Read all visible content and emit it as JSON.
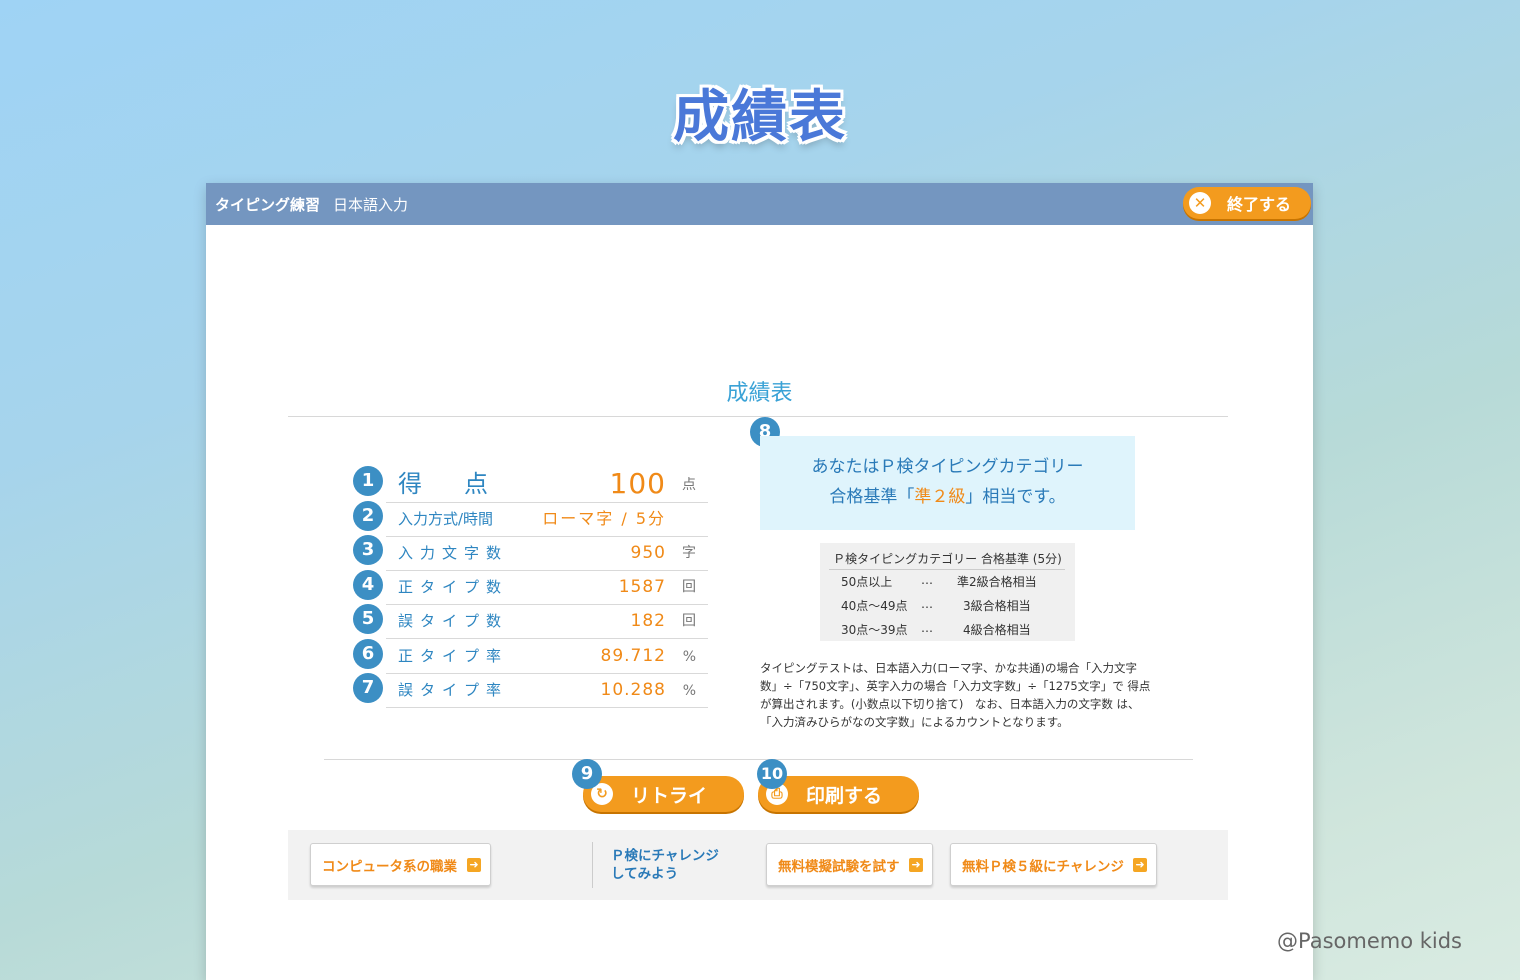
{
  "hero": {
    "title": "成績表"
  },
  "window": {
    "app_name": "タイピング練習",
    "mode_name": "日本語入力",
    "quit_label": "終了する"
  },
  "sheet": {
    "title": "成績表",
    "rows": [
      {
        "num": "1",
        "label": "得点",
        "value": "100",
        "unit": "点"
      },
      {
        "num": "2",
        "label": "入力方式/時間",
        "value": "ローマ字 / 5分",
        "unit": ""
      },
      {
        "num": "3",
        "label": "入力文字数",
        "value": "950",
        "unit": "字"
      },
      {
        "num": "4",
        "label": "正タイプ数",
        "value": "1587",
        "unit": "回"
      },
      {
        "num": "5",
        "label": "誤タイプ数",
        "value": "182",
        "unit": "回"
      },
      {
        "num": "6",
        "label": "正タイプ率",
        "value": "89.712",
        "unit": "%"
      },
      {
        "num": "7",
        "label": "誤タイプ率",
        "value": "10.288",
        "unit": "%"
      }
    ],
    "rank": {
      "num": "8",
      "line1": "あなたはＰ検タイピングカテゴリー",
      "line2_prefix": "合格基準「",
      "grade": "準２級",
      "line2_suffix": "」相当です。"
    },
    "criteria": {
      "header": "Ｐ検タイピングカテゴリー 合格基準 (5分)",
      "rows": [
        {
          "range": "50点以上",
          "sep": "…",
          "level": "準2級合格相当"
        },
        {
          "range": "40点〜49点",
          "sep": "…",
          "level": "3級合格相当"
        },
        {
          "range": "30点〜39点",
          "sep": "…",
          "level": "4級合格相当"
        }
      ]
    },
    "note_lines": [
      "タイピングテストは、日本語入力(ローマ字、かな共通)の場合「入力文字",
      "数」÷「750文字」、英字入力の場合「入力文字数」÷「1275文字」で 得点",
      "が算出されます。(小数点以下切り捨て)　なお、日本語入力の文字数 は、",
      "「入力済みひらがなの文字数」によるカウントとなります。"
    ],
    "actions": {
      "retry": {
        "num": "9",
        "label": "リトライ"
      },
      "print": {
        "num": "10",
        "label": "印刷する"
      }
    }
  },
  "footer": {
    "careers": "コンピュータ系の職業",
    "challenge_line1": "Ｐ検にチャレンジ",
    "challenge_line2": "してみよう",
    "mock_exam": "無料模擬試験を試す",
    "level5": "無料Ｐ検５級にチャレンジ"
  },
  "credit": "@Pasomemo kids",
  "colors": {
    "accent_orange": "#f39b1e",
    "badge_blue": "#3c8fc4",
    "titlebar": "#7496c0",
    "label_blue": "#2e86c1"
  }
}
